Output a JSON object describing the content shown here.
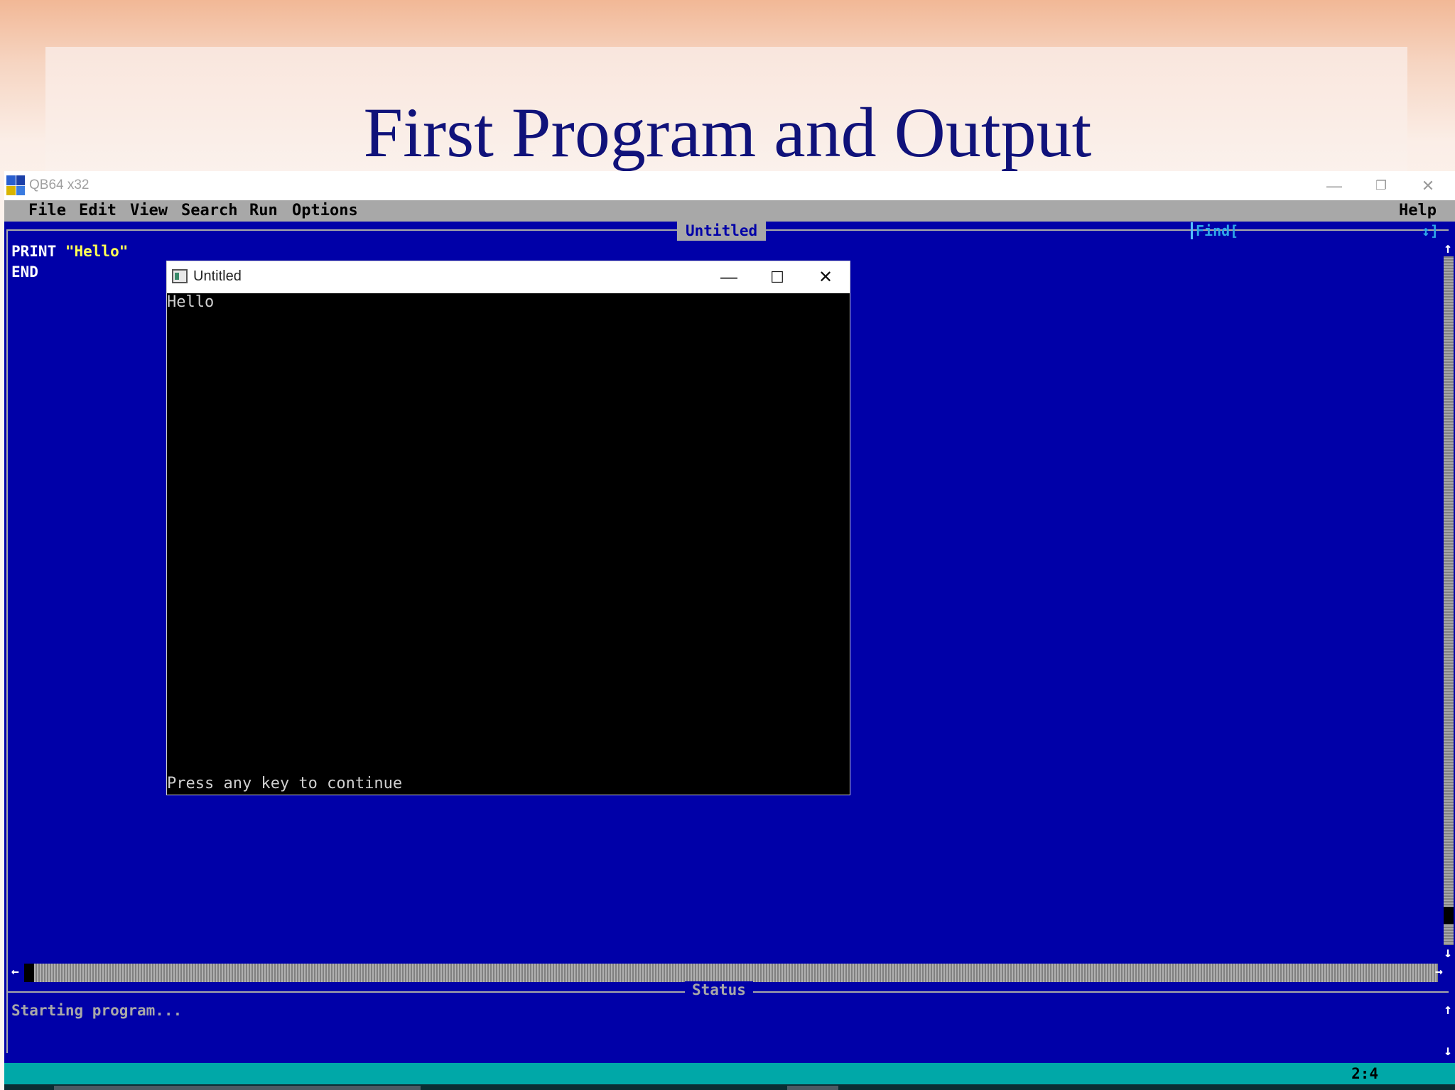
{
  "slide": {
    "title": "First Program and Output"
  },
  "qb_window": {
    "title": "QB64 x32",
    "menu": {
      "file": "File",
      "edit": "Edit",
      "view": "View",
      "search": "Search",
      "run": "Run",
      "options": "Options",
      "help": "Help"
    },
    "editor_tab_title": "Untitled",
    "find_label": "Find[",
    "find_arrows": "↕]",
    "code": {
      "line1_keyword": "PRINT ",
      "line1_string": "\"Hello\"",
      "line2": "END"
    },
    "status_label": "Status",
    "status_text": "Starting program...",
    "cursor_position": "2:4"
  },
  "output_window": {
    "title": "Untitled",
    "output_line": "Hello",
    "prompt": "Press any key to continue"
  },
  "colors": {
    "ide_background": "#0000a8",
    "menu_background": "#a8a8a8",
    "status_bar": "#00a8a8",
    "string_literal": "#ffff54",
    "slide_title": "#10127a"
  },
  "icons": {
    "minimize": "minimize-icon",
    "maximize": "maximize-icon",
    "close": "close-icon"
  }
}
